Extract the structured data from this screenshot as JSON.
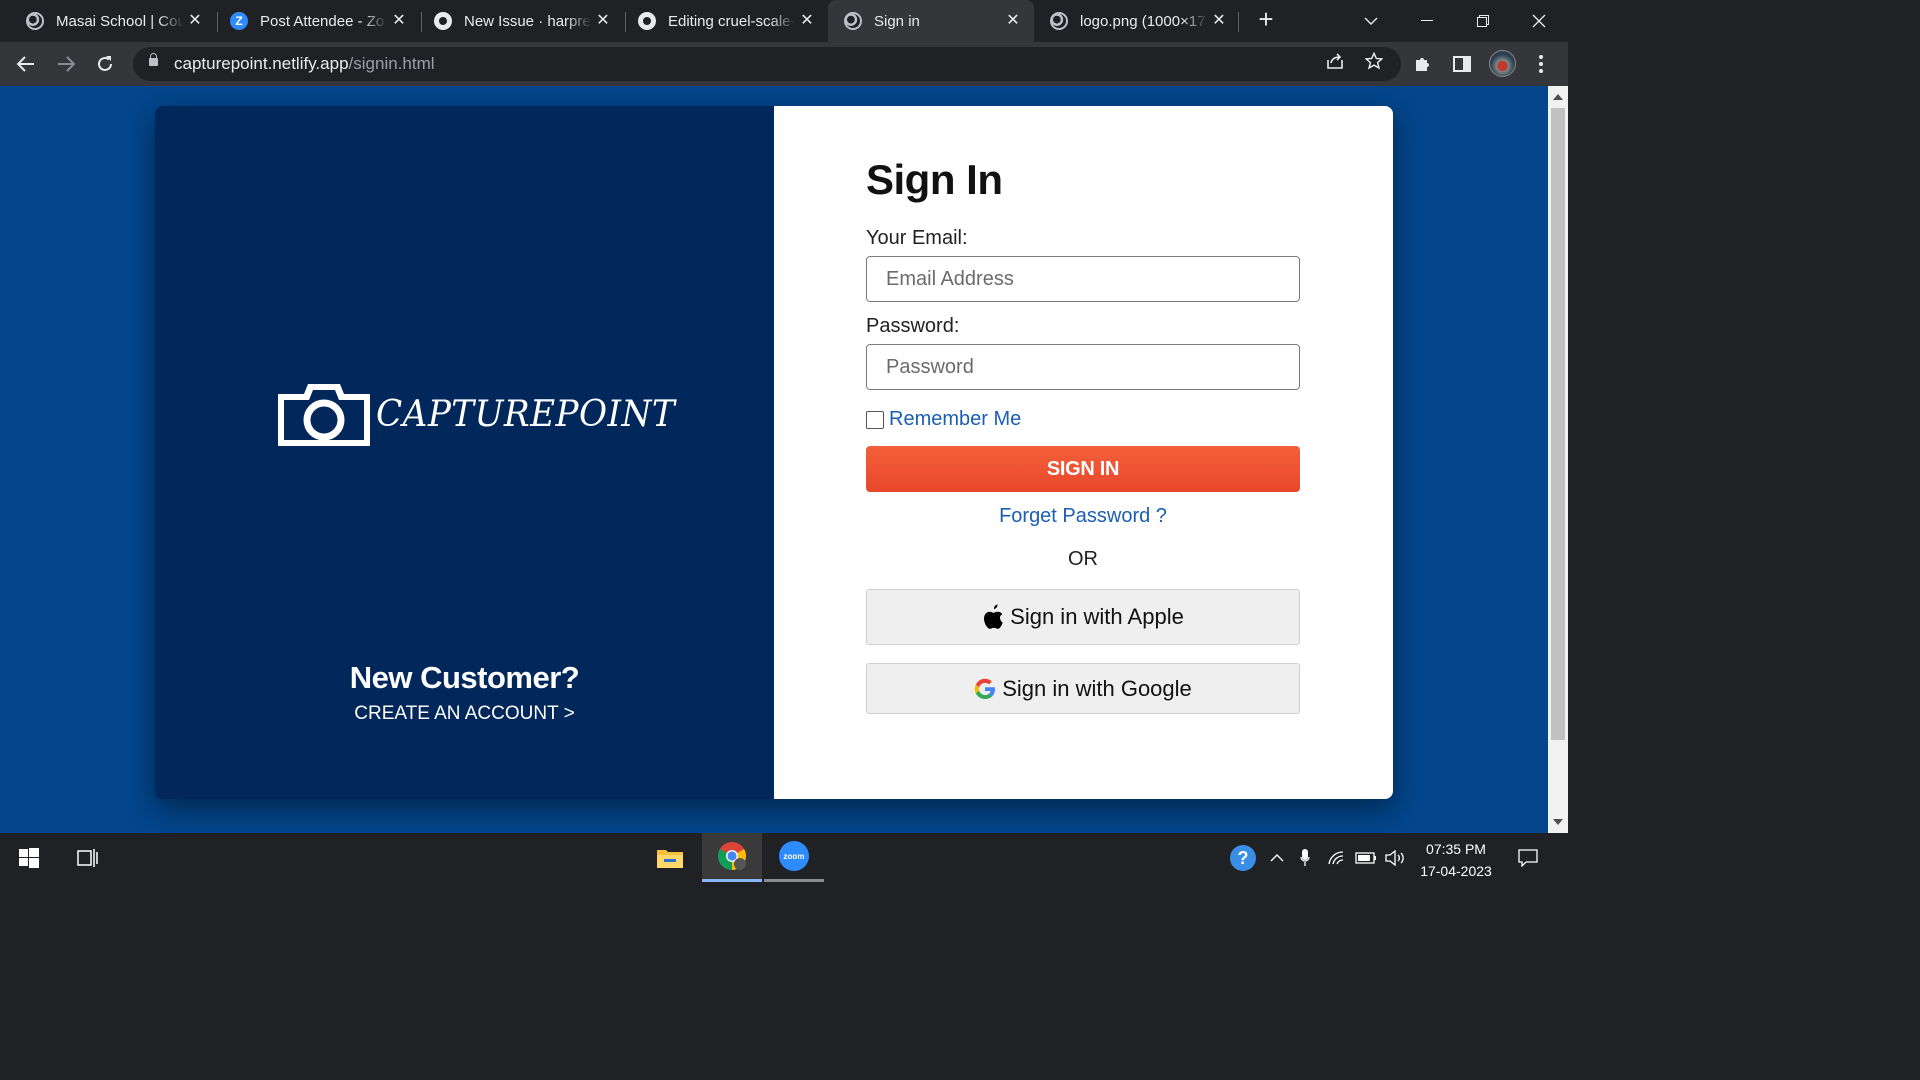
{
  "browser": {
    "tabs": [
      {
        "title": "Masai School | Cou",
        "favicon": "globe-icon",
        "active": false
      },
      {
        "title": "Post Attendee - Zo",
        "favicon": "zoom-icon",
        "active": false
      },
      {
        "title": "New Issue · harpree",
        "favicon": "github-icon",
        "active": false
      },
      {
        "title": "Editing cruel-scale-",
        "favicon": "github-icon",
        "active": false
      },
      {
        "title": "Sign in",
        "favicon": "globe-icon",
        "active": true
      },
      {
        "title": "logo.png (1000×17",
        "favicon": "globe-icon",
        "active": false
      }
    ],
    "zoom_favicon_letter": "Z",
    "url_host": "capturepoint.netlify.app",
    "url_path": "/signin.html"
  },
  "page": {
    "brand": "CAPTUREPOINT",
    "new_customer_heading": "New Customer?",
    "create_account_link": "CREATE AN ACCOUNT >",
    "signin_title": "Sign In",
    "email_label": "Your Email:",
    "email_placeholder": "Email Address",
    "password_label": "Password:",
    "password_placeholder": "Password",
    "remember_label": "Remember Me",
    "signin_button": "SIGN IN",
    "forgot_link": "Forget Password ?",
    "or_text": "OR",
    "apple_button": "Sign in with Apple",
    "google_button": "Sign in with Google"
  },
  "colors": {
    "page_background": "#03468c",
    "left_panel": "#02275a",
    "signin_button": "#e8472b",
    "link": "#1a5fb4"
  },
  "taskbar": {
    "time": "07:35 PM",
    "date": "17-04-2023",
    "zoom_label": "zoom"
  }
}
